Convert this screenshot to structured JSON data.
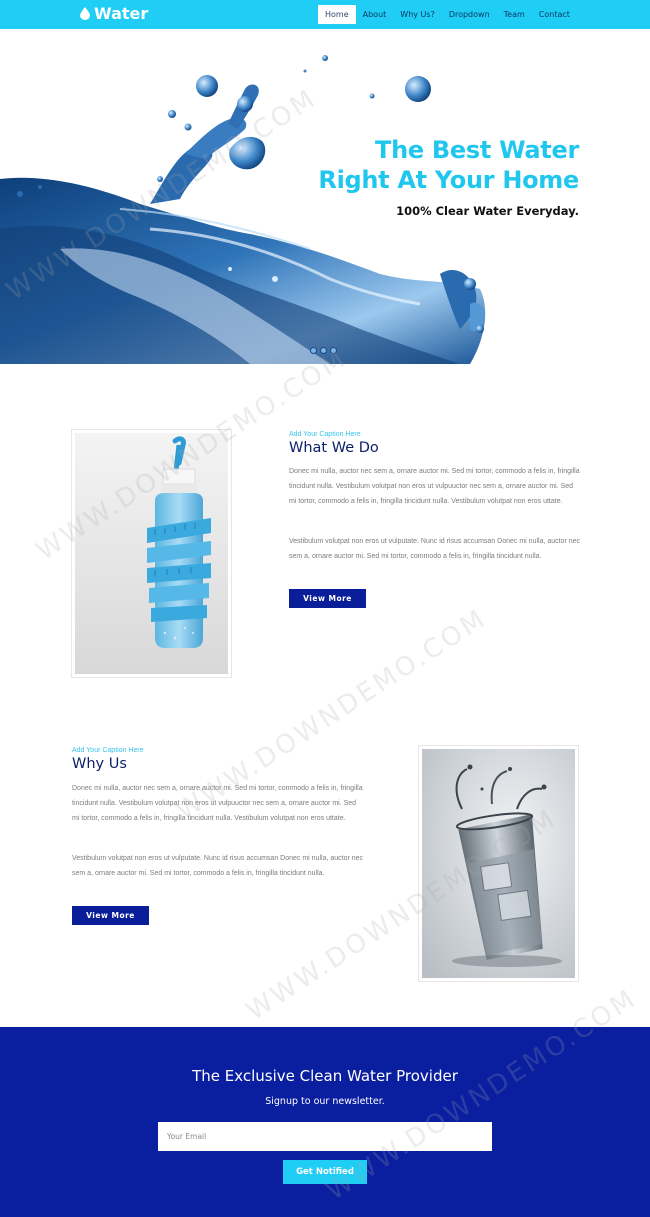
{
  "brand": {
    "name": "Water",
    "icon": "water-drop-icon"
  },
  "nav": {
    "items": [
      {
        "label": "Home",
        "active": true
      },
      {
        "label": "About"
      },
      {
        "label": "Why Us?"
      },
      {
        "label": "Dropdown"
      },
      {
        "label": "Team"
      },
      {
        "label": "Contact"
      }
    ]
  },
  "hero": {
    "title_line1": "The Best Water",
    "title_line2": "Right At Your Home",
    "subtitle": "100% Clear Water Everyday.",
    "slide_dots": 3
  },
  "what_we_do": {
    "caption": "Add Your Caption Here",
    "title": "What We Do",
    "para1": "Donec mi nulla, auctor nec sem a, ornare auctor mi. Sed mi tortor, commodo a felis in, fringilla tincidunt nulla. Vestibulum volutpat non eros ut vulpuuctor nec sem a, ornare auctor mi. Sed mi tortor, commodo a felis in, fringilla tincidunt nulla. Vestibulum volutpat non eros uttate.",
    "para2": "Vestibulum volutpat non eros ut vulputate. Nunc id risus accumsan Donec mi nulla, auctor nec sem a, ornare auctor mi. Sed mi tortor, commodo a felis in, fringilla tincidunt nulla.",
    "button": "View More"
  },
  "why_us": {
    "caption": "Add Your Caption Here",
    "title": "Why Us",
    "para1": "Donec mi nulla, auctor nec sem a, ornare auctor mi. Sed mi tortor, commodo a felis in, fringilla tincidunt nulla. Vestibulum volutpat non eros ut vulpuuctor nec sem a, ornare auctor mi. Sed mi tortor, commodo a felis in, fringilla tincidunt nulla. Vestibulum volutpat non eros uttate.",
    "para2": "Vestibulum volutpat non eros ut vulputate. Nunc id risus accumsan Donec mi nulla, auctor nec sem a, ornare auctor mi. Sed mi tortor, commodo a felis in, fringilla tincidunt nulla.",
    "button": "View More"
  },
  "newsletter": {
    "title": "The Exclusive Clean Water Provider",
    "subtitle": "Signup to our newsletter.",
    "email_placeholder": "Your Email",
    "button": "Get Notified"
  },
  "watermark": "WWW.DOWNDEMO.COM",
  "colors": {
    "nav_bg": "#1fcdf5",
    "accent_cyan": "#1fc7ef",
    "navy": "#0a1fa0",
    "title_navy": "#0c1f6a",
    "text_grey": "#7c7c7c"
  }
}
